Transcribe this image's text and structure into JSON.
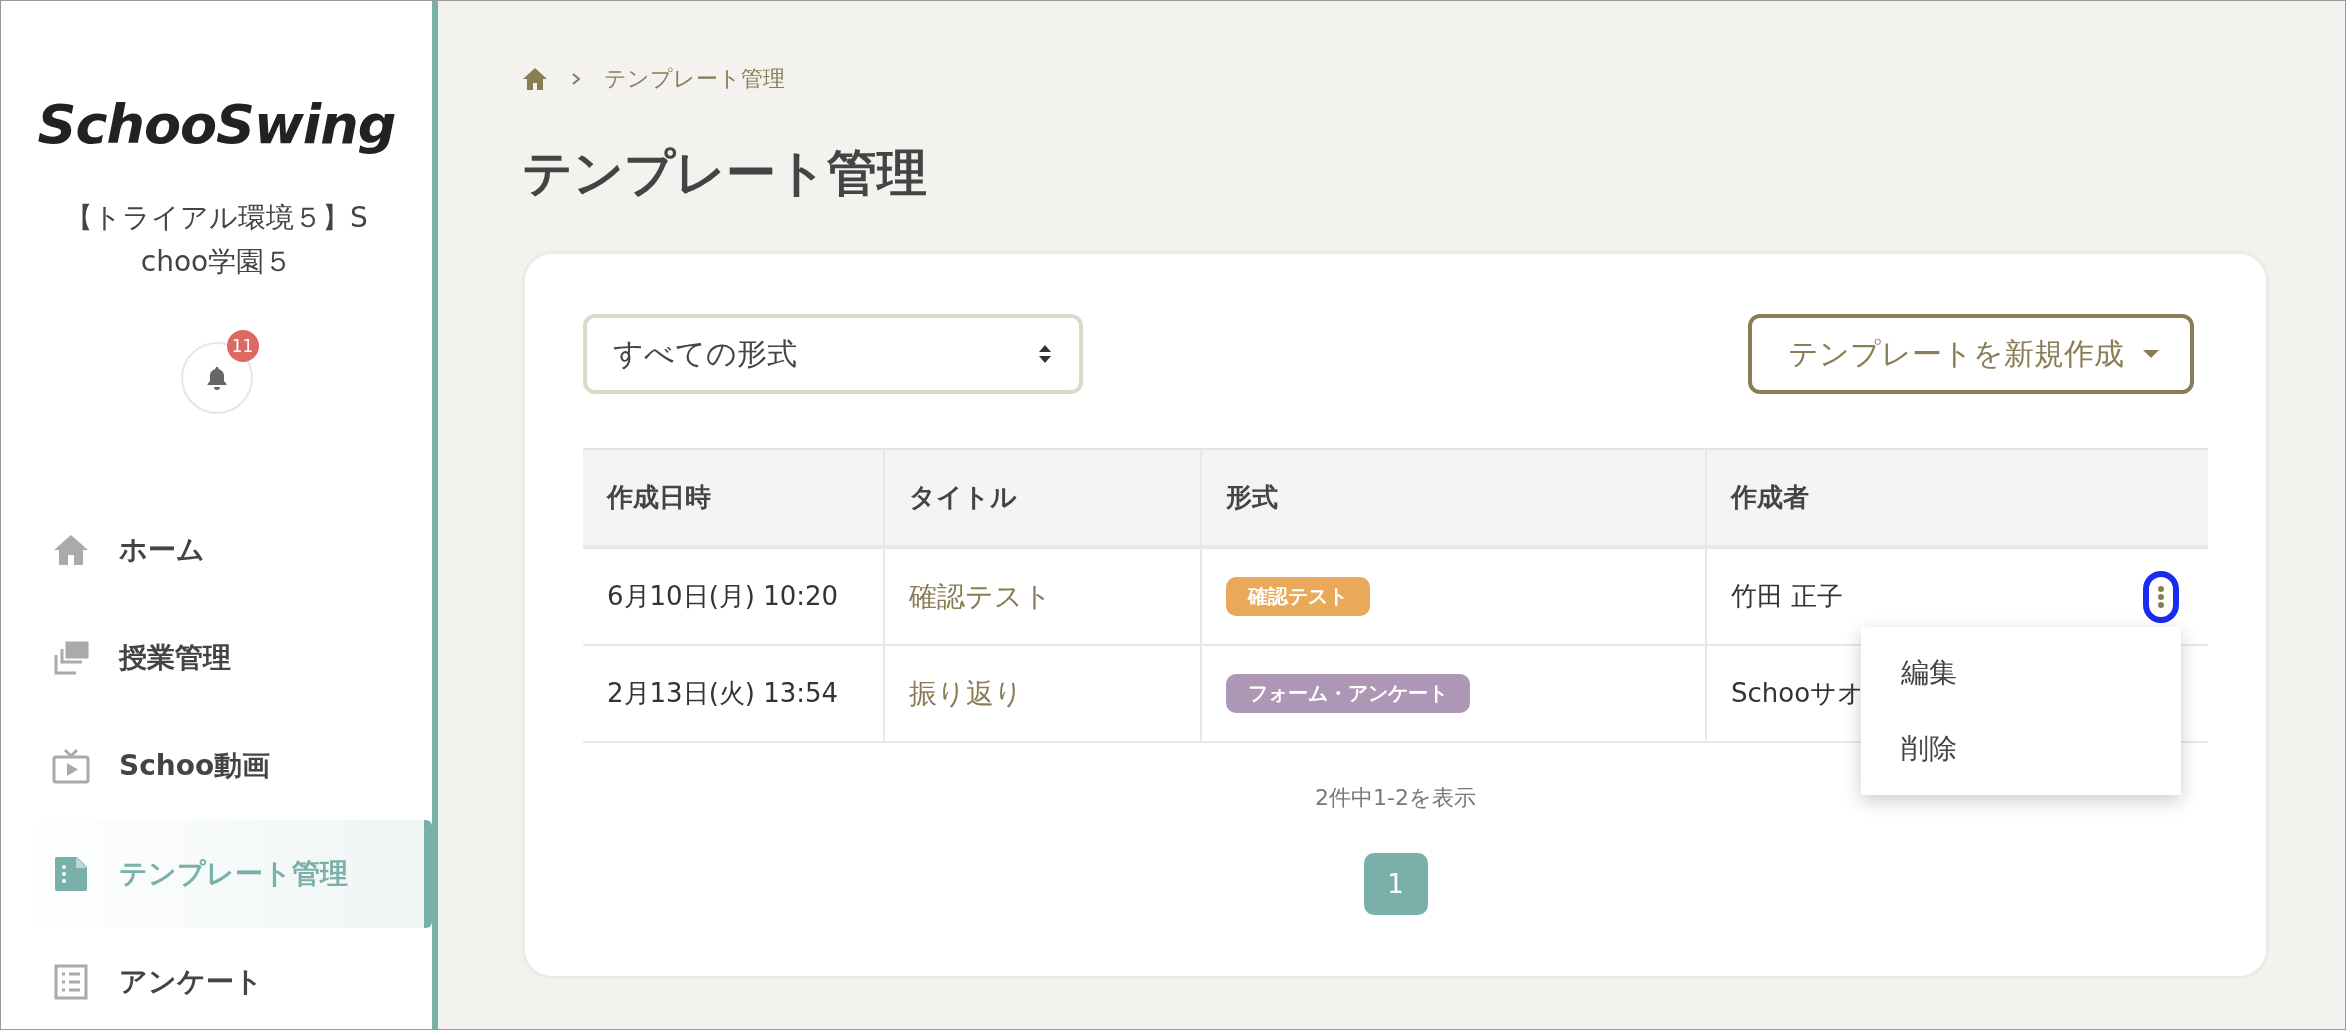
{
  "sidebar": {
    "logo": "SchooSwing",
    "organization": "【トライアル環境５】Schoo学園５",
    "notifications": {
      "count": "11"
    },
    "items": [
      {
        "label": "ホーム",
        "kind": "home",
        "selected": false
      },
      {
        "label": "授業管理",
        "kind": "classes",
        "selected": false
      },
      {
        "label": "Schoo動画",
        "kind": "video",
        "selected": false
      },
      {
        "label": "テンプレート管理",
        "kind": "template",
        "selected": true
      },
      {
        "label": "アンケート",
        "kind": "survey",
        "selected": false
      }
    ]
  },
  "breadcrumb": {
    "items": [
      "テンプレート管理"
    ]
  },
  "page_title": "テンプレート管理",
  "filter": {
    "value": "すべての形式"
  },
  "create_button": "テンプレートを新規作成",
  "table": {
    "columns": [
      "作成日時",
      "タイトル",
      "形式",
      "作成者"
    ],
    "rows": [
      {
        "date": "6月10日(月) 10:20",
        "title": "確認テスト",
        "format": {
          "label": "確認テスト",
          "color": "#e9a85a"
        },
        "author": "竹田 正子",
        "menu_open": true
      },
      {
        "date": "2月13日(火) 13:54",
        "title": "振り返り",
        "format": {
          "label": "フォーム・アンケート",
          "color": "#ae96b5"
        },
        "author": "Schooサオ",
        "menu_open": false
      }
    ]
  },
  "row_menu": {
    "items": [
      "編集",
      "削除"
    ]
  },
  "pagination": {
    "summary": "2件中1-2を表示",
    "pages": [
      {
        "label": "1",
        "selected": true
      }
    ]
  }
}
